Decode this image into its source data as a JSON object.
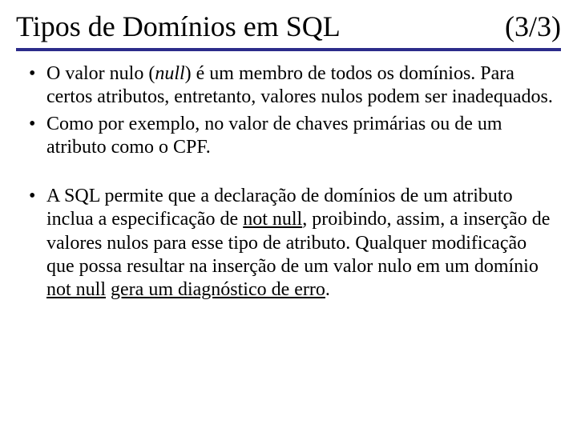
{
  "title": {
    "left": "Tipos de Domínios em SQL",
    "right": "(3/3)"
  },
  "bullets": [
    {
      "runs": [
        {
          "t": "O valor nulo ("
        },
        {
          "t": "null",
          "italic": true
        },
        {
          "t": ") é um membro de todos os domínios. Para certos atributos, entretanto, valores nulos podem ser inadequados."
        }
      ]
    },
    {
      "runs": [
        {
          "t": "Como por exemplo, no valor de chaves primárias ou de um atributo como o CPF."
        }
      ]
    },
    {
      "spacer": true
    },
    {
      "runs": [
        {
          "t": "A SQL permite que a declaração de domínios de um atributo inclua a especificação de "
        },
        {
          "t": "not null",
          "underline": true
        },
        {
          "t": ", proibindo, assim, a inserção de valores nulos para esse tipo de atributo. Qualquer modificação que possa resultar na inserção de um valor nulo em um domínio "
        },
        {
          "t": "not null",
          "underline": true
        },
        {
          "t": " "
        },
        {
          "t": "gera um diagnóstico de erro",
          "underline": true
        },
        {
          "t": "."
        }
      ]
    }
  ]
}
